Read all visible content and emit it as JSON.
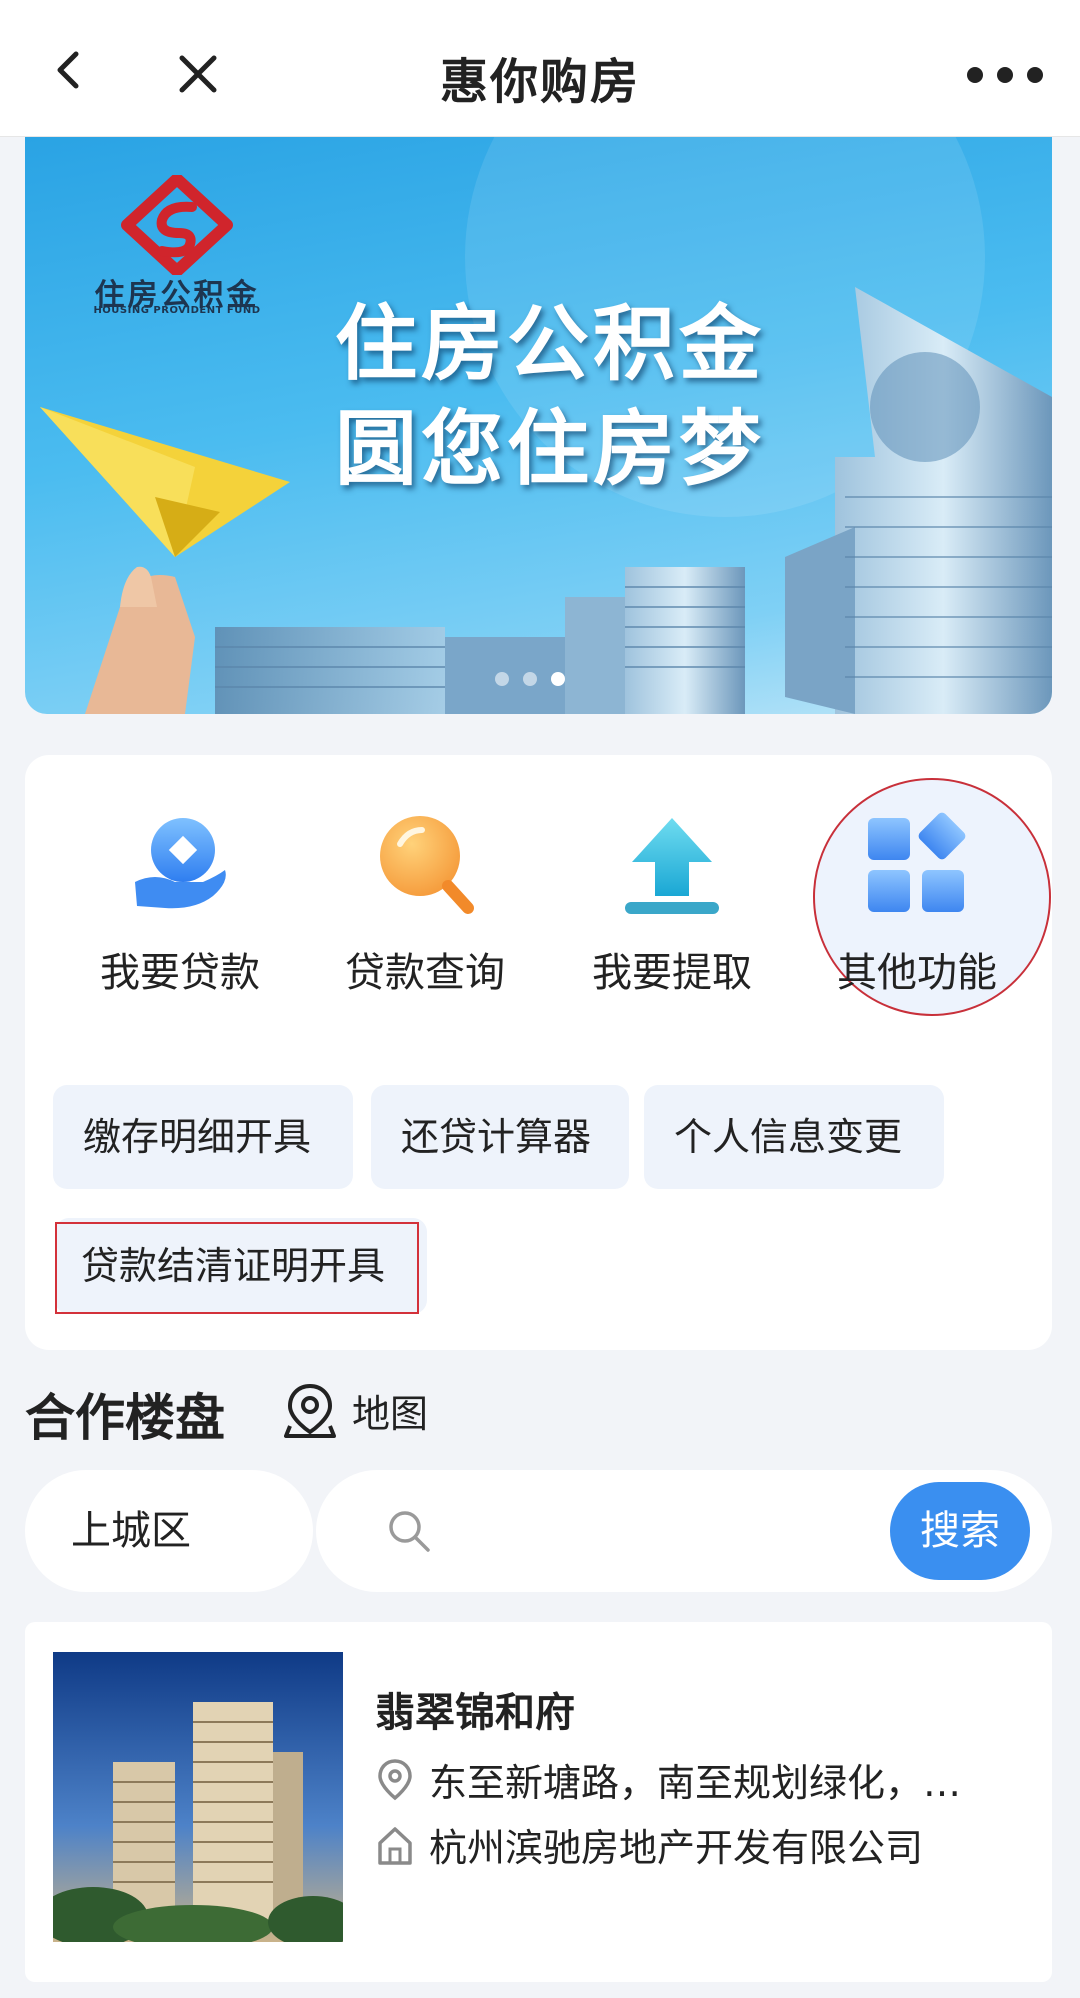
{
  "nav": {
    "title": "惠你购房",
    "back_icon": "chevron-left-icon",
    "close_icon": "close-icon",
    "more_icon": "more-dots-icon"
  },
  "banner": {
    "logo_text": "住房公积金",
    "logo_subtitle": "HOUSING PROVIDENT FUND",
    "slogan_line1": "住房公积金",
    "slogan_line2": "圆您住房梦",
    "active_slide": 3,
    "slide_count": 3
  },
  "functions": [
    {
      "label": "我要贷款",
      "icon": "loan-hand-icon"
    },
    {
      "label": "贷款查询",
      "icon": "magnifier-icon"
    },
    {
      "label": "我要提取",
      "icon": "upload-arrow-icon"
    },
    {
      "label": "其他功能",
      "icon": "apps-grid-icon"
    }
  ],
  "chips": [
    {
      "label": "缴存明细开具"
    },
    {
      "label": "还贷计算器"
    },
    {
      "label": "个人信息变更"
    },
    {
      "label": "贷款结清证明开具"
    }
  ],
  "section": {
    "title": "合作楼盘",
    "map_label": "地图"
  },
  "search": {
    "district": "上城区",
    "placeholder": "",
    "button": "搜索"
  },
  "property": {
    "name": "翡翠锦和府",
    "address": "东至新塘路，南至规划绿化，…",
    "developer": "杭州滨驰房地产开发有限公司"
  },
  "colors": {
    "accent": "#3a8ff0",
    "highlight": "#d3313a",
    "background": "#f2f4f8"
  }
}
